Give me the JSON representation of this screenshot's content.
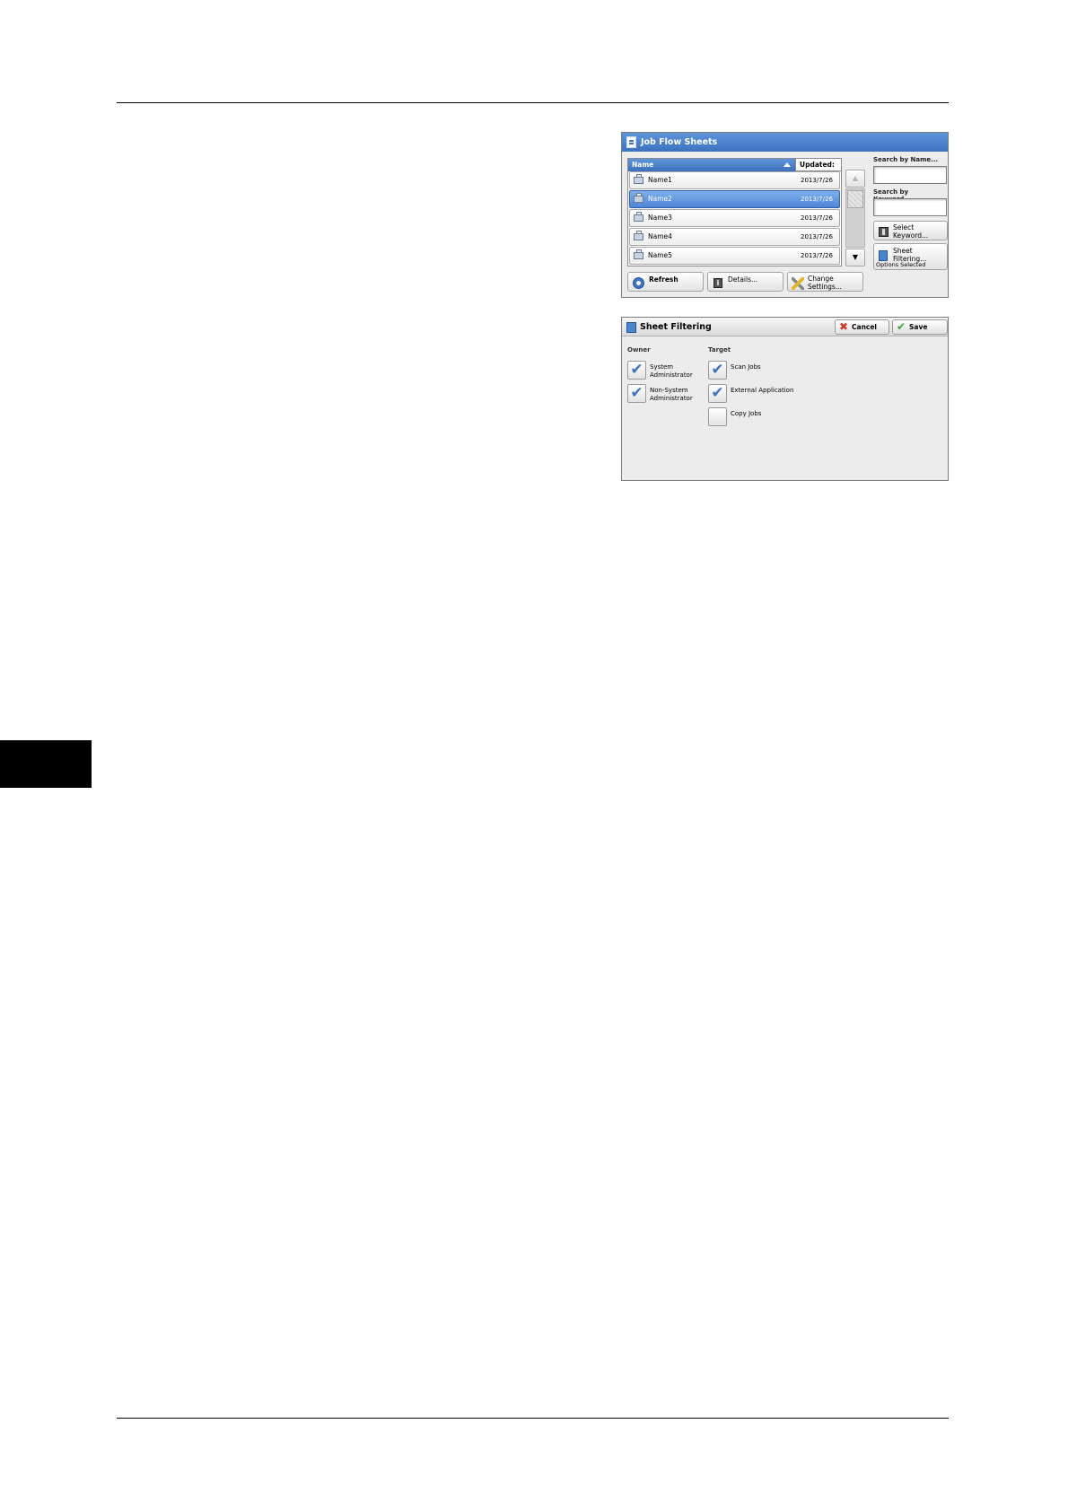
{
  "job_flow_sheets": {
    "title": "Job Flow Sheets",
    "columns": {
      "name": "Name",
      "updated": "Updated:"
    },
    "rows": [
      {
        "name": "Name1",
        "date": "2013/7/26",
        "selected": false
      },
      {
        "name": "Name2",
        "date": "2013/7/26",
        "selected": true
      },
      {
        "name": "Name3",
        "date": "2013/7/26",
        "selected": false
      },
      {
        "name": "Name4",
        "date": "2013/7/26",
        "selected": false
      },
      {
        "name": "Name5",
        "date": "2013/7/26",
        "selected": false
      }
    ],
    "scroll": {
      "up_icon": "up-arrow",
      "down_icon": "down-arrow"
    },
    "search_by_name": {
      "label": "Search by Name...",
      "value": ""
    },
    "search_by_keyword": {
      "label": "Search by Keyword...",
      "value": ""
    },
    "select_keyword": {
      "line1": "Select",
      "line2": "Keyword..."
    },
    "sheet_filtering": {
      "label": "Sheet Filtering...",
      "status": "Options Selected"
    },
    "refresh": "Refresh",
    "details": "Details...",
    "change_settings": {
      "line1": "Change",
      "line2": "Settings..."
    }
  },
  "sheet_filtering_dialog": {
    "title": "Sheet Filtering",
    "cancel": "Cancel",
    "save": "Save",
    "owner": {
      "label": "Owner",
      "items": [
        {
          "line1": "System",
          "line2": "Administrator",
          "checked": true
        },
        {
          "line1": "Non-System",
          "line2": "Administrator",
          "checked": true
        }
      ]
    },
    "target": {
      "label": "Target",
      "items": [
        {
          "label": "Scan Jobs",
          "checked": true
        },
        {
          "label": "External Application",
          "checked": true
        },
        {
          "label": "Copy Jobs",
          "checked": false
        }
      ]
    }
  },
  "colors": {
    "accent": "#3c73c2",
    "selected_row": "#4d86d6",
    "cancel_icon": "#d23a2a",
    "save_icon": "#3aa43a"
  }
}
